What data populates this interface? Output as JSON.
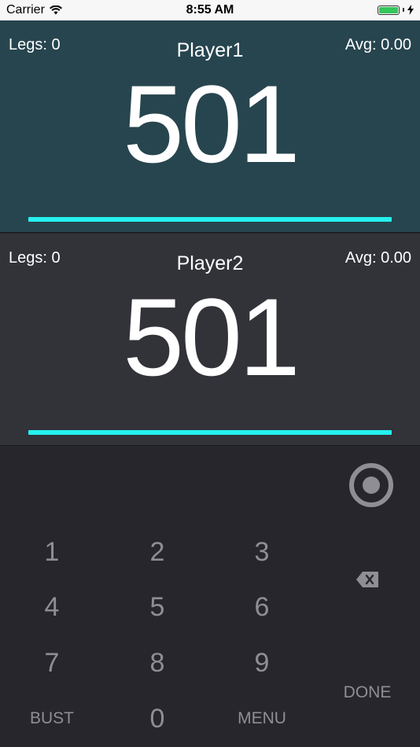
{
  "status_bar": {
    "carrier": "Carrier",
    "time": "8:55 AM"
  },
  "players": [
    {
      "legs_label": "Legs: 0",
      "name": "Player1",
      "avg_label": "Avg: 0.00",
      "score": "501",
      "progress": 1.0,
      "bg_color": "#27454f"
    },
    {
      "legs_label": "Legs: 0",
      "name": "Player2",
      "avg_label": "Avg: 0.00",
      "score": "501",
      "progress": 1.0,
      "bg_color": "#323239"
    }
  ],
  "keypad": {
    "keys": [
      "1",
      "2",
      "3",
      "4",
      "5",
      "6",
      "7",
      "8",
      "9"
    ],
    "bust": "BUST",
    "zero": "0",
    "menu": "MENU",
    "done": "DONE",
    "dart_icon": "dartboard-target-icon",
    "backspace_icon": "backspace-icon"
  },
  "colors": {
    "progress": "#25f0ef",
    "keypad_text": "#8e8e94",
    "keypad_bg": "#26262c"
  }
}
